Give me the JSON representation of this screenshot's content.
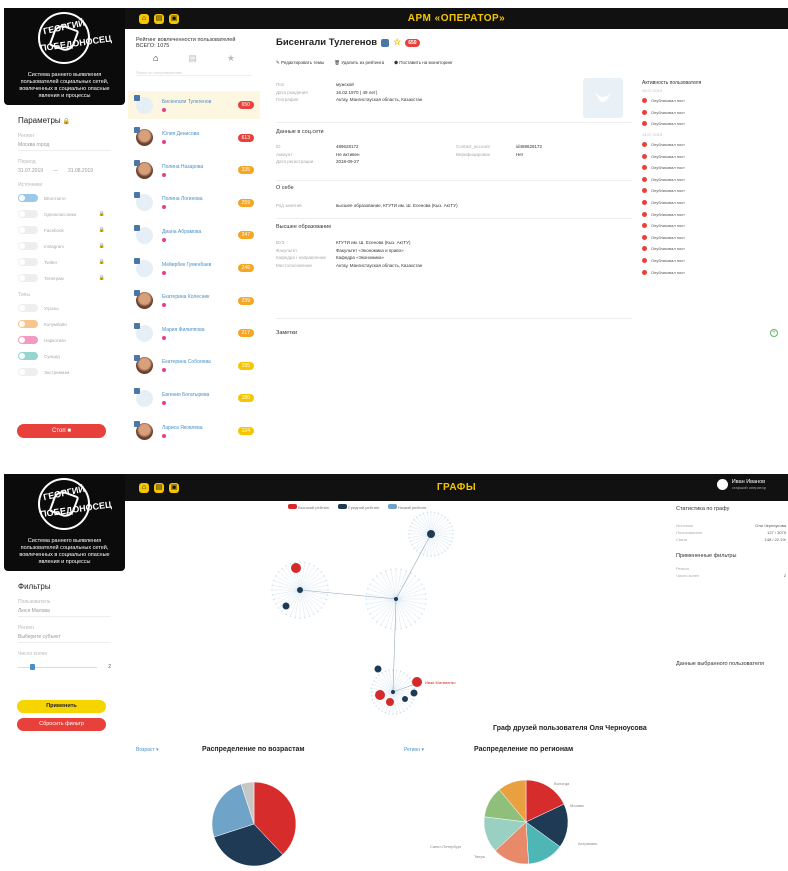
{
  "colors": {
    "accent": "#f5c500",
    "danger": "#e8413c",
    "vk": "#4a76a8",
    "orange": "#f5a623",
    "link": "#4a90c8"
  },
  "logo": {
    "line1": "ГЕОРГИЙ",
    "line2": "ПОБЕДОНОСЕЦ",
    "desc": "Система раннего выявления пользователей социальных сетей, вовлеченных в социально опасные явления и процессы"
  },
  "top1": {
    "title": "АРМ «ОПЕРАТОР»",
    "icons": [
      "home-icon",
      "folder-icon",
      "image-icon"
    ]
  },
  "params": {
    "title": "Параметры",
    "region_label": "Регион",
    "region": "Москва город",
    "period_label": "Период",
    "date_from": "31.07.2019",
    "date_to": "31.08.2019",
    "sources_label": "Источники",
    "sources": [
      "ВКонтакте",
      "Одноклассники",
      "Facebook",
      "Instagram",
      "Twitter",
      "Телеграм"
    ],
    "types_label": "Типы",
    "types": [
      "Угрозы",
      "Колумбайн",
      "Наркотики",
      "Суицид",
      "Экстремизм"
    ],
    "stop": "Стоп"
  },
  "ulist": {
    "title": "Рейтинг вовлеченности пользователей",
    "total": "ВСЕГО: 1075",
    "search": "Поиск по пользователям",
    "users": [
      {
        "name": "Бисенгали Тулегенов",
        "score": "650",
        "color": "#e8413c",
        "photo": false
      },
      {
        "name": "Юлия Денисова",
        "score": "613",
        "color": "#e8413c",
        "photo": true
      },
      {
        "name": "Полина Назарова",
        "score": "335",
        "color": "#f5a623",
        "photo": true
      },
      {
        "name": "Полина Логинова",
        "score": "259",
        "color": "#f5a623",
        "photo": false
      },
      {
        "name": "Диана Абрамова",
        "score": "247",
        "color": "#f5a623",
        "photo": false
      },
      {
        "name": "Мейирбек Гуменбаев",
        "score": "246",
        "color": "#f5a623",
        "photo": false
      },
      {
        "name": "Екатерина Колесник",
        "score": "239",
        "color": "#f5a623",
        "photo": true
      },
      {
        "name": "Мария Филиппова",
        "score": "217",
        "color": "#f5a623",
        "photo": false
      },
      {
        "name": "Екатерина Соболева",
        "score": "195",
        "color": "#f5c500",
        "photo": true
      },
      {
        "name": "Евгения Богатырева",
        "score": "180",
        "color": "#f5c500",
        "photo": false
      },
      {
        "name": "Лариса Яковлева",
        "score": "124",
        "color": "#f5c500",
        "photo": true
      }
    ]
  },
  "profile": {
    "name": "Бисенгали Тулегенов",
    "score": "650",
    "actions": [
      "Редактировать темы",
      "Удалить из рейтинга",
      "Поставить на мониторинг"
    ],
    "basic": [
      [
        "Пол",
        "мужской"
      ],
      [
        "Дата рождения",
        "16.02.1970 ( 49 лет)"
      ],
      [
        "География",
        "Актау, Мангистауская область, Казахстан"
      ]
    ],
    "social_title": "Данные в соц.сети",
    "social": [
      [
        "ID",
        "489628172"
      ],
      [
        "Аккаунт",
        "Не активен"
      ],
      [
        "Дата регистрации",
        "2018-09-27"
      ]
    ],
    "social_right": [
      [
        "Contact_account",
        "id489628172"
      ],
      [
        "Верифицирован",
        "Нет"
      ]
    ],
    "about_title": "О себе",
    "about": [
      [
        "Род занятий",
        "высшее образование, КГУТИ им. Ш. Есенова (Кыз. АктГУ)"
      ]
    ],
    "edu_title": "Высшее образование",
    "edu": [
      [
        "ВУЗ",
        "КГУТИ им. Ш. Есенова (Кыз. АктГУ)"
      ],
      [
        "Факультет",
        "Факультет «Экономика и право»"
      ],
      [
        "Кафедра / направление",
        "Кафедра «Экономика»"
      ],
      [
        "Местоположение",
        "Актау, Мангистауская область, Казахстан"
      ]
    ],
    "notes": "Заметки"
  },
  "activity": {
    "title": "Активность пользователя",
    "groups": [
      {
        "date": "26.07.2019",
        "items": [
          "Опубликовал пост",
          "Опубликовал пост",
          "Опубликовал пост"
        ]
      },
      {
        "date": "14.07.2019",
        "items": [
          "Опубликовал пост",
          "Опубликовал пост",
          "Опубликовал пост",
          "Опубликовал пост",
          "Опубликовал пост",
          "Опубликовал пост",
          "Опубликовал пост",
          "Опубликовал пост",
          "Опубликовал пост",
          "Опубликовал пост",
          "Опубликовал пост",
          "Опубликовал пост"
        ]
      }
    ]
  },
  "top2": {
    "title": "ГРАФЫ",
    "user": "Иван Иванов",
    "role": "старший оператор"
  },
  "filters": {
    "title": "Фильтры",
    "user_label": "Пользователь",
    "user": "Люся Малова",
    "region_label": "Регион",
    "region": "Выберите субъект",
    "depth_label": "Число колен",
    "depth": "2",
    "apply": "Применить",
    "reset": "Сбросить фильтр"
  },
  "graph": {
    "legend": [
      "Высокий рейтинг",
      "Средний рейтинг",
      "Низкий рейтинг"
    ],
    "legend_colors": [
      "#d42a2a",
      "#1f3a55",
      "#6fa3c8"
    ],
    "node_label": "Иван Матвиенко",
    "caption": "Граф друзей пользователя Оля Черноусова"
  },
  "gstats": {
    "title": "Статистика по графу",
    "rows": [
      [
        "Источник",
        "Оля Черноусова"
      ],
      [
        "Пользователи",
        "127 / 3075"
      ],
      [
        "Связи",
        "148 / 22.1%"
      ]
    ],
    "filters_title": "Примененные фильтры",
    "filter_rows": [
      [
        "Регион",
        ""
      ],
      [
        "Число колен",
        "2"
      ]
    ],
    "selected": "Данные выбранного пользователя"
  },
  "pies": [
    {
      "selector": "Возраст",
      "title": "Распределение по возрастам"
    },
    {
      "selector": "Регион",
      "title": "Распределение по регионам"
    }
  ],
  "chart_data": [
    {
      "type": "pie",
      "title": "Распределение по возрастам",
      "values": [
        38,
        32,
        25,
        5
      ],
      "colors": [
        "#d62c2c",
        "#1f3a55",
        "#6fa3c8",
        "#c7c7c7"
      ]
    },
    {
      "type": "pie",
      "title": "Распределение по регионам",
      "values": [
        18,
        17,
        14,
        14,
        14,
        12,
        11
      ],
      "colors": [
        "#d62c2c",
        "#1f3a55",
        "#4fb6b6",
        "#e8896a",
        "#9ad0c2",
        "#8fbf7a",
        "#e8a040"
      ],
      "labels": [
        "Вологда",
        "Москва",
        "Астрахань",
        "",
        "",
        "Санкт-Петербург",
        "Тверь"
      ]
    }
  ]
}
